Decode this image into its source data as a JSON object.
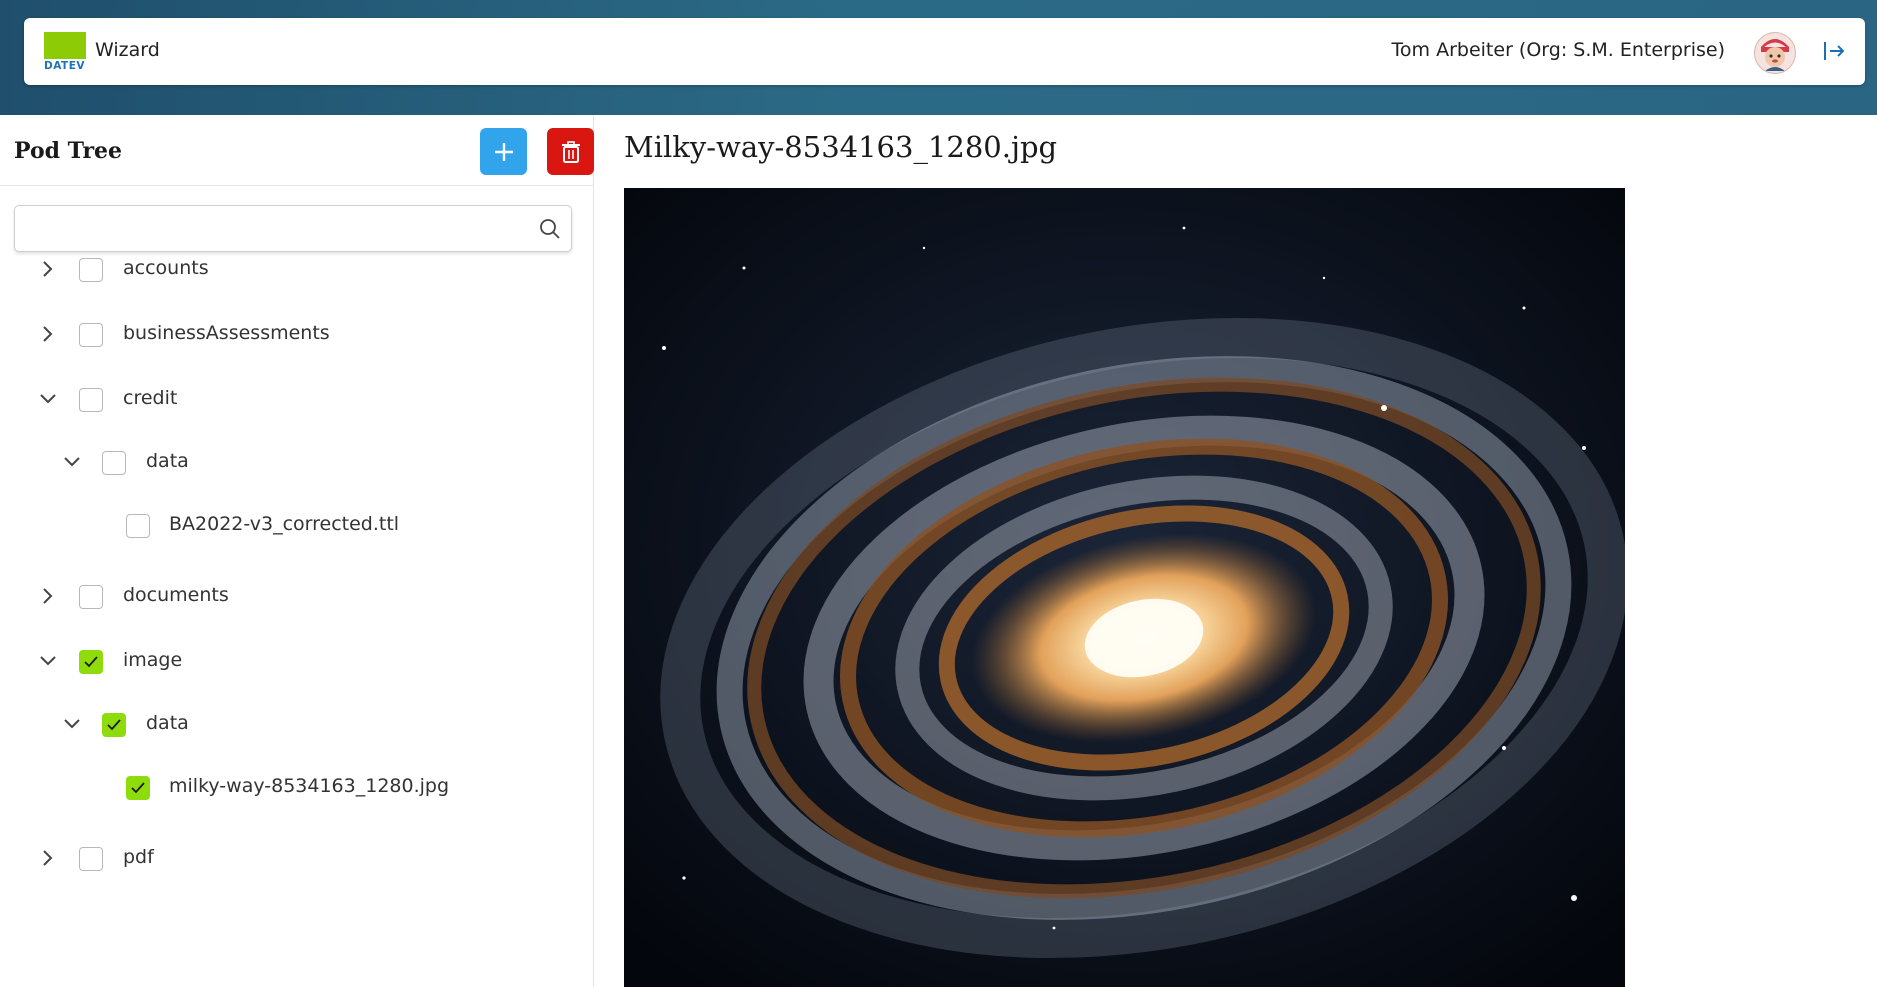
{
  "header": {
    "logo_text": "DATEV",
    "app_title": "Wizard",
    "user_label": "Tom Arbeiter (Org: S.M. Enterprise)",
    "logout_icon": "logout-arrow-icon"
  },
  "sidebar": {
    "title": "Pod Tree",
    "add_icon": "plus-icon",
    "delete_icon": "trash-icon",
    "search": {
      "value": "",
      "placeholder": ""
    },
    "tree": [
      {
        "label": "accounts",
        "expanded": false,
        "checked": false,
        "depth": 0
      },
      {
        "label": "businessAssessments",
        "expanded": false,
        "checked": false,
        "depth": 0
      },
      {
        "label": "credit",
        "expanded": true,
        "checked": false,
        "depth": 0
      },
      {
        "label": "data",
        "expanded": true,
        "checked": false,
        "depth": 1
      },
      {
        "label": "BA2022-v3_corrected.ttl",
        "leaf": true,
        "checked": false,
        "depth": 2
      },
      {
        "label": "documents",
        "expanded": false,
        "checked": false,
        "depth": 0
      },
      {
        "label": "image",
        "expanded": true,
        "checked": true,
        "depth": 0
      },
      {
        "label": "data",
        "expanded": true,
        "checked": true,
        "depth": 1
      },
      {
        "label": "milky-way-8534163_1280.jpg",
        "leaf": true,
        "checked": true,
        "depth": 2
      },
      {
        "label": "pdf",
        "expanded": false,
        "checked": false,
        "depth": 0
      }
    ]
  },
  "main": {
    "title": "Milky-way-8534163_1280.jpg",
    "image_alt": "spiral galaxy image"
  },
  "colors": {
    "accent_green": "#8fdc0c",
    "add_blue": "#31a4ec",
    "delete_red": "#d9160f",
    "header_band": "#2b6a86"
  }
}
